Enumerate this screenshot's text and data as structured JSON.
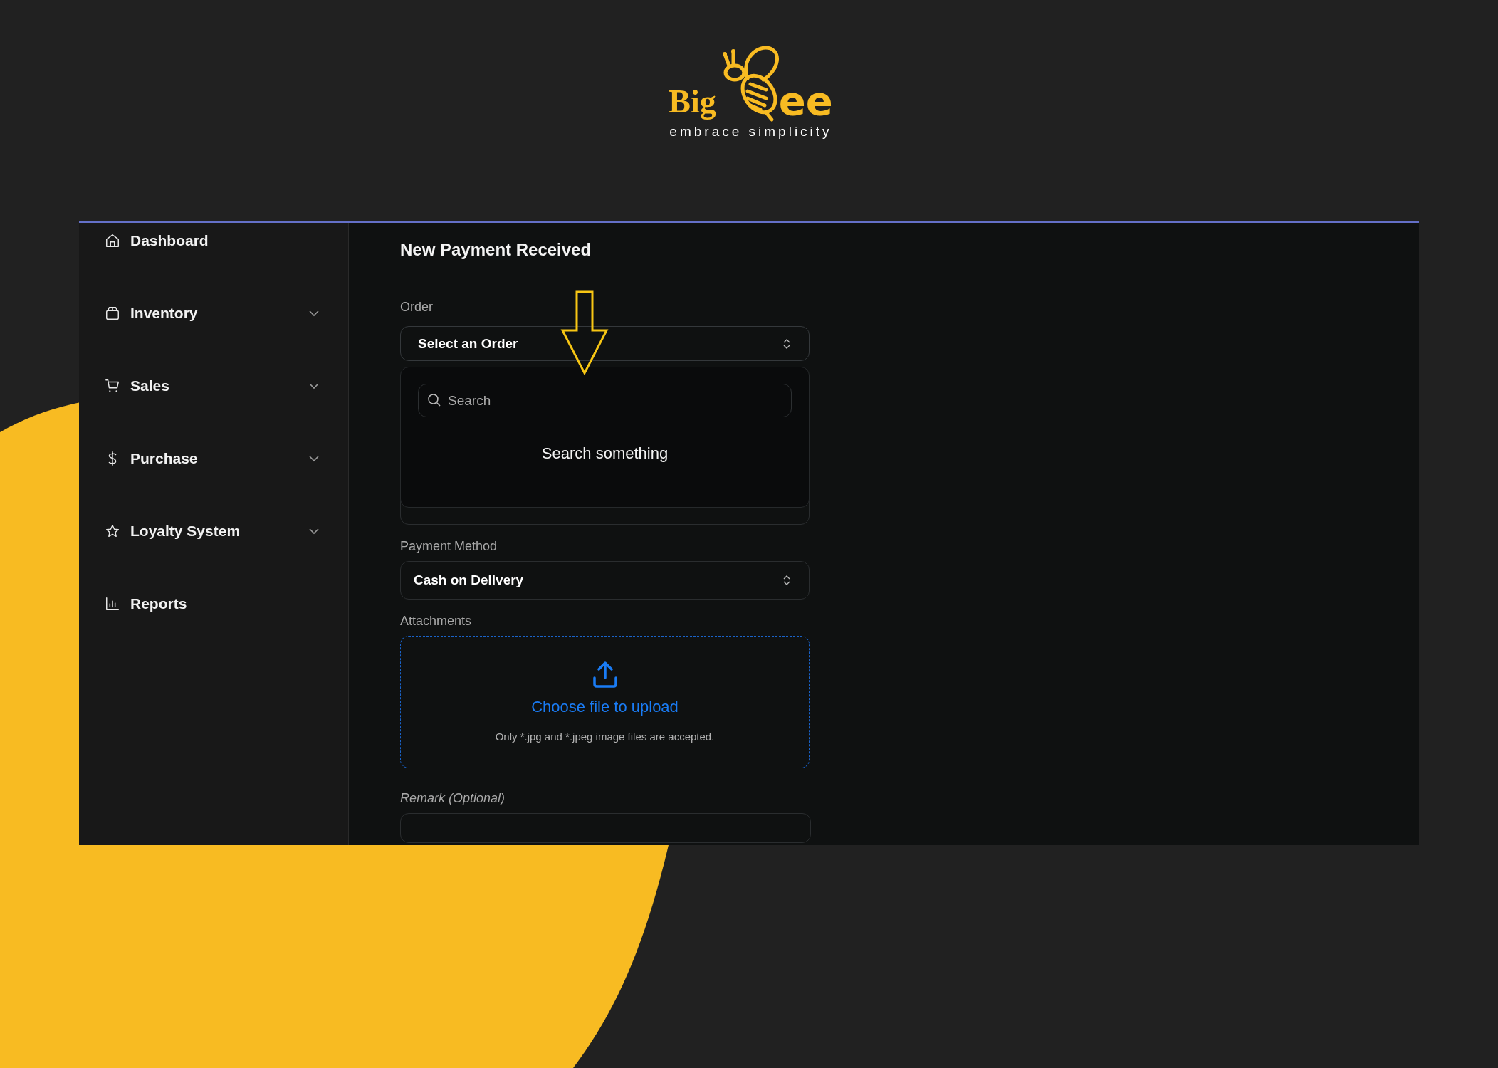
{
  "logo": {
    "word_left": "Big",
    "word_right": "ee",
    "tagline": "embrace simplicity"
  },
  "sidebar": {
    "items": [
      {
        "label": "Dashboard",
        "expandable": false
      },
      {
        "label": "Inventory",
        "expandable": true
      },
      {
        "label": "Sales",
        "expandable": true
      },
      {
        "label": "Purchase",
        "expandable": true
      },
      {
        "label": "Loyalty System",
        "expandable": true
      },
      {
        "label": "Reports",
        "expandable": false
      }
    ]
  },
  "form": {
    "title": "New Payment Received",
    "order": {
      "label": "Order",
      "value": "Select an Order",
      "expanded": true,
      "search_placeholder": "Search",
      "empty_text": "Search something"
    },
    "payment_method": {
      "label": "Payment Method",
      "value": "Cash on Delivery"
    },
    "attachments": {
      "label": "Attachments",
      "action": "Choose file to upload",
      "hint": "Only *.jpg and *.jpeg image files are accepted."
    },
    "remark": {
      "label": "Remark (Optional)"
    }
  }
}
